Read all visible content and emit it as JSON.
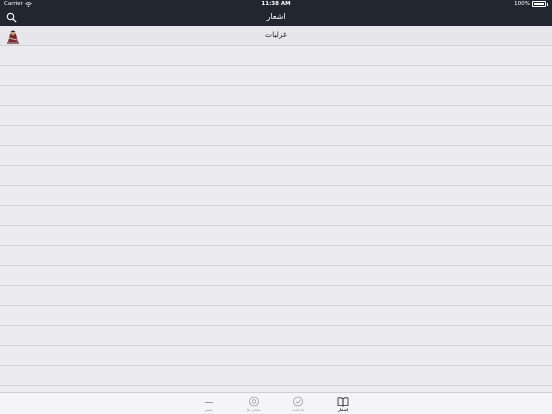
{
  "status_bar": {
    "carrier": "Carrier",
    "time": "11:38 AM",
    "battery": "100%"
  },
  "nav": {
    "title": "اشعار"
  },
  "list": {
    "items": [
      {
        "label": "غزلیات",
        "icon": "poet-portrait-thumbnail"
      }
    ]
  },
  "tabs": [
    {
      "label": "بیشتر",
      "icon": "more-icon"
    },
    {
      "label": "منتخب ها",
      "icon": "favorites-icon"
    },
    {
      "label": "یادداشت",
      "icon": "notes-icon"
    },
    {
      "label": "اشعار",
      "icon": "book-icon",
      "active": true
    }
  ],
  "colors": {
    "bar": "#222631",
    "background": "#ececef",
    "divider": "#d2d2d6",
    "tab_inactive": "#9a9aa2"
  }
}
